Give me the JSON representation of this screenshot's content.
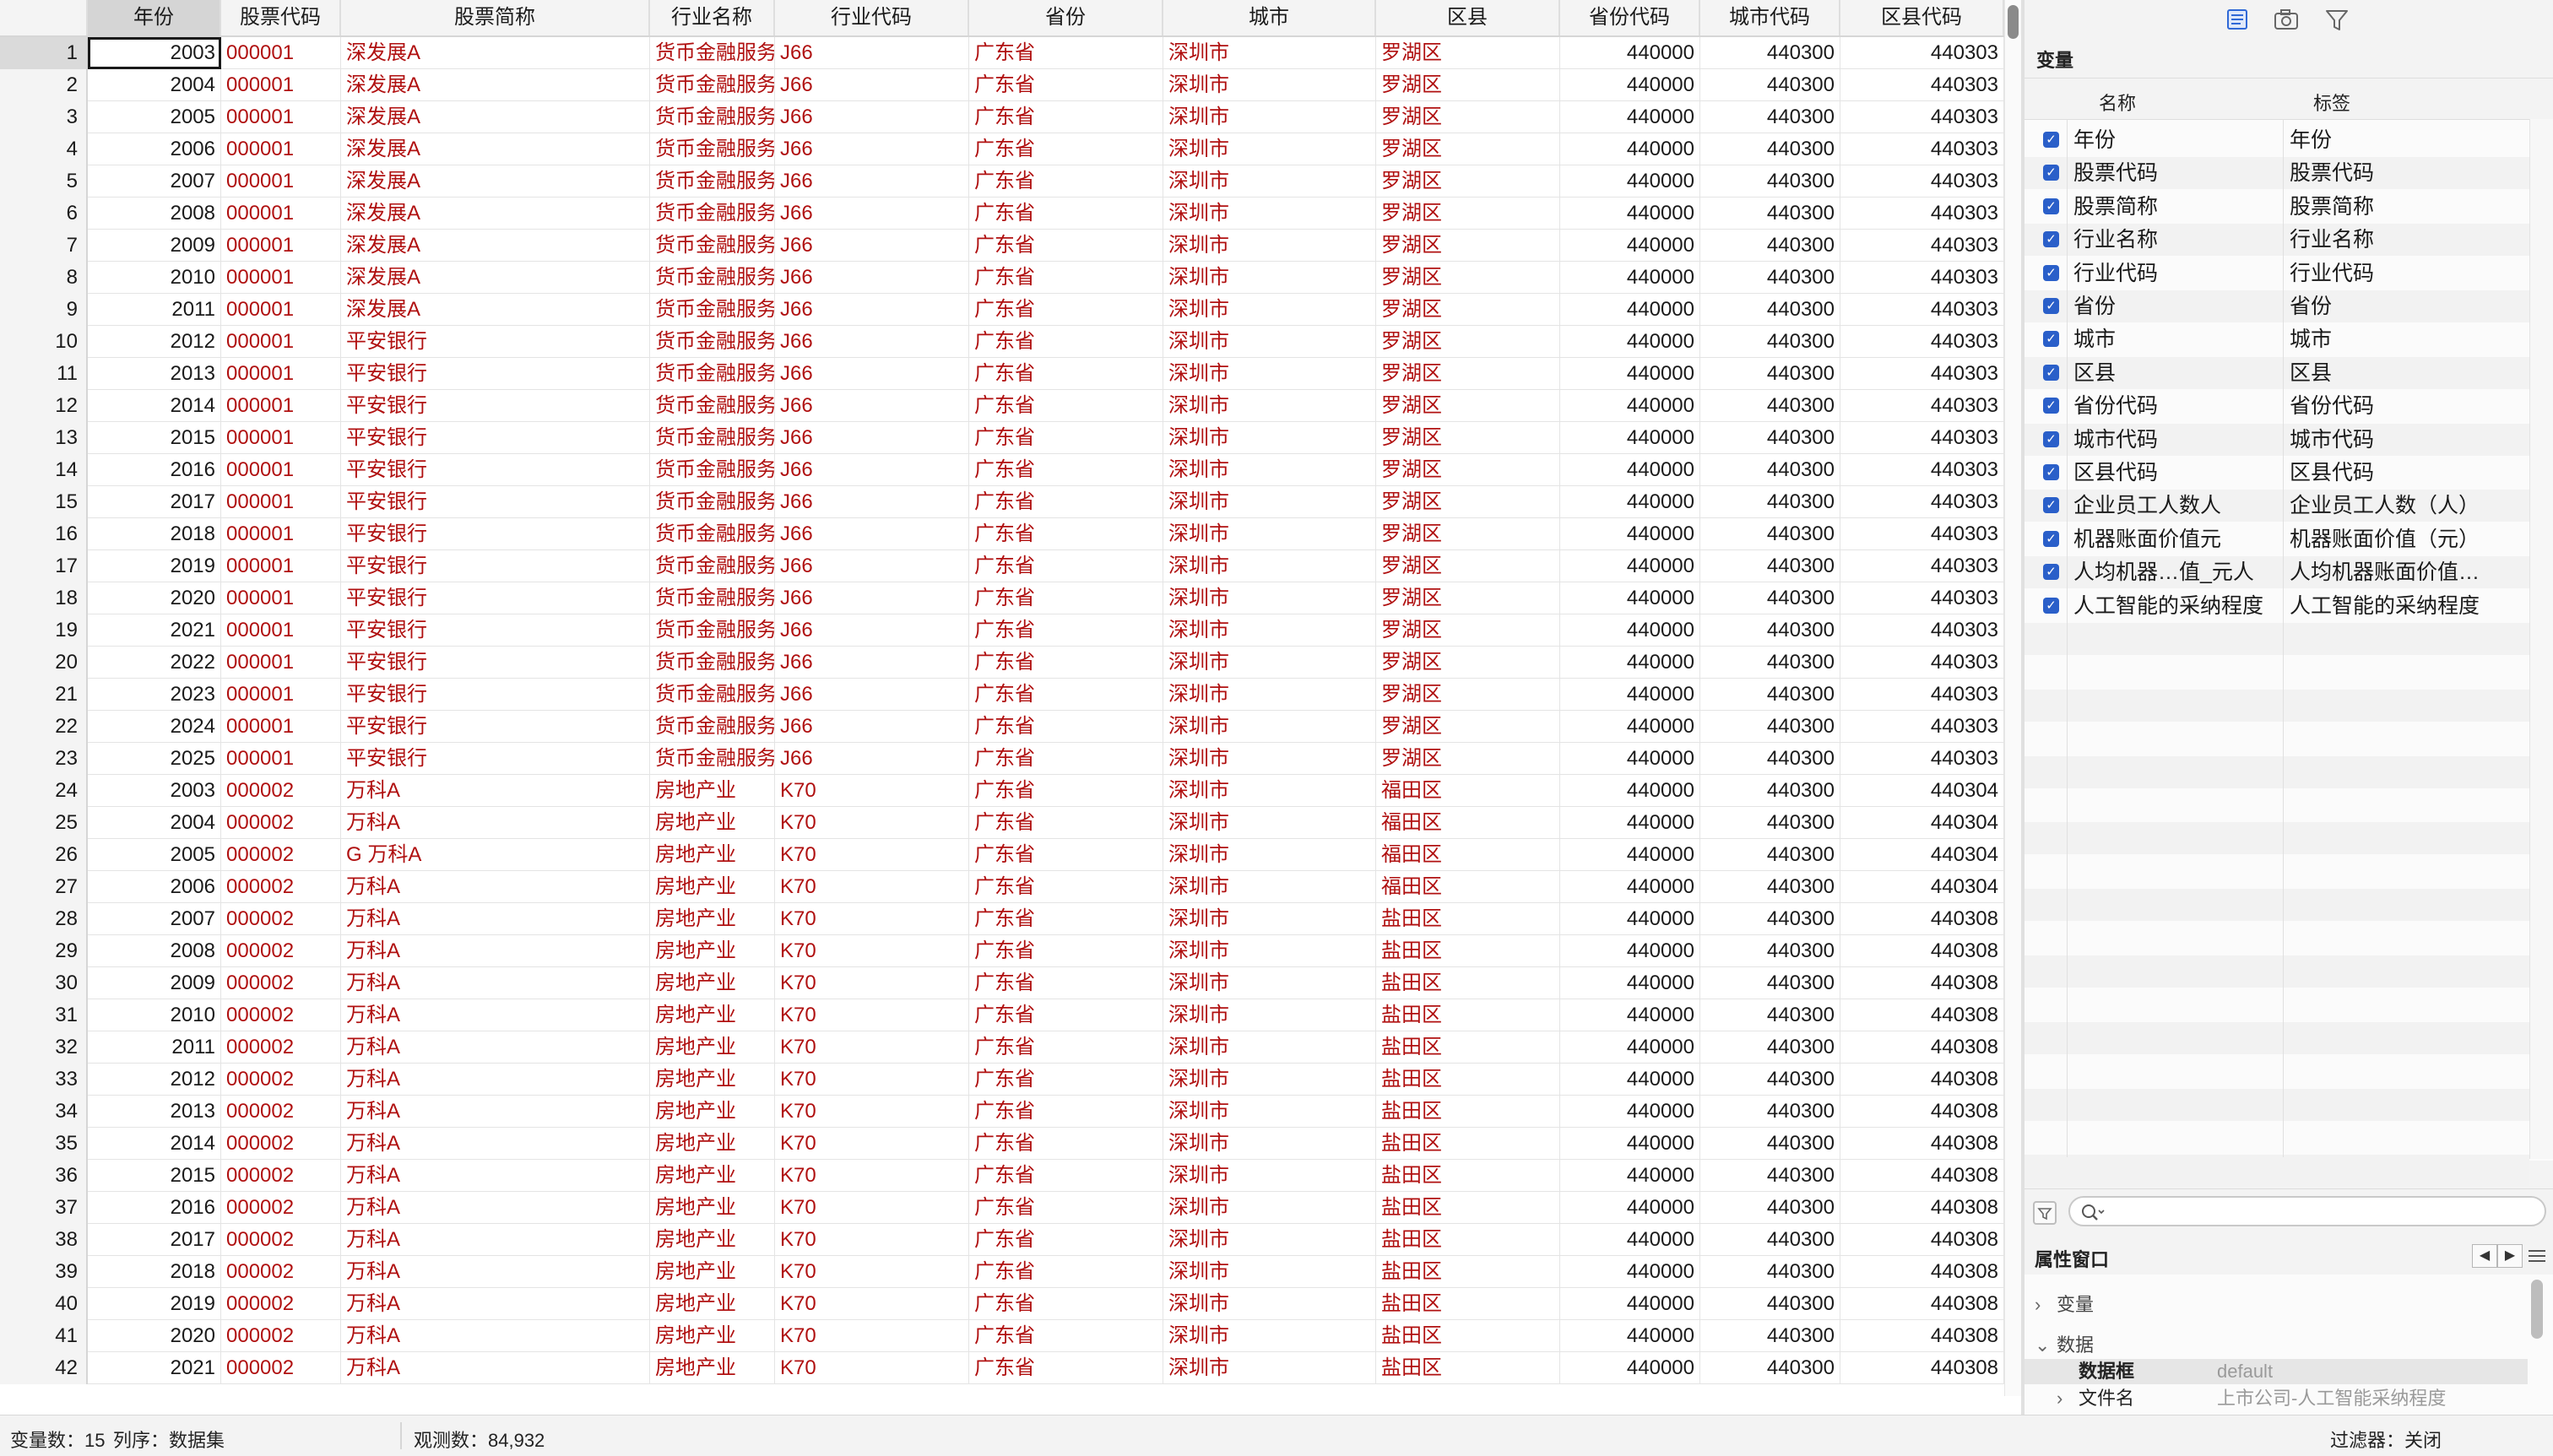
{
  "grid": {
    "columns": [
      "年份",
      "股票代码",
      "股票简称",
      "行业名称",
      "行业代码",
      "省份",
      "城市",
      "区县",
      "省份代码",
      "城市代码",
      "区县代码"
    ],
    "rows": [
      [
        1,
        "2003",
        "000001",
        "深发展A",
        "货币金融服务",
        "J66",
        "广东省",
        "深圳市",
        "罗湖区",
        "440000",
        "440300",
        "440303"
      ],
      [
        2,
        "2004",
        "000001",
        "深发展A",
        "货币金融服务",
        "J66",
        "广东省",
        "深圳市",
        "罗湖区",
        "440000",
        "440300",
        "440303"
      ],
      [
        3,
        "2005",
        "000001",
        "深发展A",
        "货币金融服务",
        "J66",
        "广东省",
        "深圳市",
        "罗湖区",
        "440000",
        "440300",
        "440303"
      ],
      [
        4,
        "2006",
        "000001",
        "深发展A",
        "货币金融服务",
        "J66",
        "广东省",
        "深圳市",
        "罗湖区",
        "440000",
        "440300",
        "440303"
      ],
      [
        5,
        "2007",
        "000001",
        "深发展A",
        "货币金融服务",
        "J66",
        "广东省",
        "深圳市",
        "罗湖区",
        "440000",
        "440300",
        "440303"
      ],
      [
        6,
        "2008",
        "000001",
        "深发展A",
        "货币金融服务",
        "J66",
        "广东省",
        "深圳市",
        "罗湖区",
        "440000",
        "440300",
        "440303"
      ],
      [
        7,
        "2009",
        "000001",
        "深发展A",
        "货币金融服务",
        "J66",
        "广东省",
        "深圳市",
        "罗湖区",
        "440000",
        "440300",
        "440303"
      ],
      [
        8,
        "2010",
        "000001",
        "深发展A",
        "货币金融服务",
        "J66",
        "广东省",
        "深圳市",
        "罗湖区",
        "440000",
        "440300",
        "440303"
      ],
      [
        9,
        "2011",
        "000001",
        "深发展A",
        "货币金融服务",
        "J66",
        "广东省",
        "深圳市",
        "罗湖区",
        "440000",
        "440300",
        "440303"
      ],
      [
        10,
        "2012",
        "000001",
        "平安银行",
        "货币金融服务",
        "J66",
        "广东省",
        "深圳市",
        "罗湖区",
        "440000",
        "440300",
        "440303"
      ],
      [
        11,
        "2013",
        "000001",
        "平安银行",
        "货币金融服务",
        "J66",
        "广东省",
        "深圳市",
        "罗湖区",
        "440000",
        "440300",
        "440303"
      ],
      [
        12,
        "2014",
        "000001",
        "平安银行",
        "货币金融服务",
        "J66",
        "广东省",
        "深圳市",
        "罗湖区",
        "440000",
        "440300",
        "440303"
      ],
      [
        13,
        "2015",
        "000001",
        "平安银行",
        "货币金融服务",
        "J66",
        "广东省",
        "深圳市",
        "罗湖区",
        "440000",
        "440300",
        "440303"
      ],
      [
        14,
        "2016",
        "000001",
        "平安银行",
        "货币金融服务",
        "J66",
        "广东省",
        "深圳市",
        "罗湖区",
        "440000",
        "440300",
        "440303"
      ],
      [
        15,
        "2017",
        "000001",
        "平安银行",
        "货币金融服务",
        "J66",
        "广东省",
        "深圳市",
        "罗湖区",
        "440000",
        "440300",
        "440303"
      ],
      [
        16,
        "2018",
        "000001",
        "平安银行",
        "货币金融服务",
        "J66",
        "广东省",
        "深圳市",
        "罗湖区",
        "440000",
        "440300",
        "440303"
      ],
      [
        17,
        "2019",
        "000001",
        "平安银行",
        "货币金融服务",
        "J66",
        "广东省",
        "深圳市",
        "罗湖区",
        "440000",
        "440300",
        "440303"
      ],
      [
        18,
        "2020",
        "000001",
        "平安银行",
        "货币金融服务",
        "J66",
        "广东省",
        "深圳市",
        "罗湖区",
        "440000",
        "440300",
        "440303"
      ],
      [
        19,
        "2021",
        "000001",
        "平安银行",
        "货币金融服务",
        "J66",
        "广东省",
        "深圳市",
        "罗湖区",
        "440000",
        "440300",
        "440303"
      ],
      [
        20,
        "2022",
        "000001",
        "平安银行",
        "货币金融服务",
        "J66",
        "广东省",
        "深圳市",
        "罗湖区",
        "440000",
        "440300",
        "440303"
      ],
      [
        21,
        "2023",
        "000001",
        "平安银行",
        "货币金融服务",
        "J66",
        "广东省",
        "深圳市",
        "罗湖区",
        "440000",
        "440300",
        "440303"
      ],
      [
        22,
        "2024",
        "000001",
        "平安银行",
        "货币金融服务",
        "J66",
        "广东省",
        "深圳市",
        "罗湖区",
        "440000",
        "440300",
        "440303"
      ],
      [
        23,
        "2025",
        "000001",
        "平安银行",
        "货币金融服务",
        "J66",
        "广东省",
        "深圳市",
        "罗湖区",
        "440000",
        "440300",
        "440303"
      ],
      [
        24,
        "2003",
        "000002",
        "万科A",
        "房地产业",
        "K70",
        "广东省",
        "深圳市",
        "福田区",
        "440000",
        "440300",
        "440304"
      ],
      [
        25,
        "2004",
        "000002",
        "万科A",
        "房地产业",
        "K70",
        "广东省",
        "深圳市",
        "福田区",
        "440000",
        "440300",
        "440304"
      ],
      [
        26,
        "2005",
        "000002",
        "G 万科A",
        "房地产业",
        "K70",
        "广东省",
        "深圳市",
        "福田区",
        "440000",
        "440300",
        "440304"
      ],
      [
        27,
        "2006",
        "000002",
        "万科A",
        "房地产业",
        "K70",
        "广东省",
        "深圳市",
        "福田区",
        "440000",
        "440300",
        "440304"
      ],
      [
        28,
        "2007",
        "000002",
        "万科A",
        "房地产业",
        "K70",
        "广东省",
        "深圳市",
        "盐田区",
        "440000",
        "440300",
        "440308"
      ],
      [
        29,
        "2008",
        "000002",
        "万科A",
        "房地产业",
        "K70",
        "广东省",
        "深圳市",
        "盐田区",
        "440000",
        "440300",
        "440308"
      ],
      [
        30,
        "2009",
        "000002",
        "万科A",
        "房地产业",
        "K70",
        "广东省",
        "深圳市",
        "盐田区",
        "440000",
        "440300",
        "440308"
      ],
      [
        31,
        "2010",
        "000002",
        "万科A",
        "房地产业",
        "K70",
        "广东省",
        "深圳市",
        "盐田区",
        "440000",
        "440300",
        "440308"
      ],
      [
        32,
        "2011",
        "000002",
        "万科A",
        "房地产业",
        "K70",
        "广东省",
        "深圳市",
        "盐田区",
        "440000",
        "440300",
        "440308"
      ],
      [
        33,
        "2012",
        "000002",
        "万科A",
        "房地产业",
        "K70",
        "广东省",
        "深圳市",
        "盐田区",
        "440000",
        "440300",
        "440308"
      ],
      [
        34,
        "2013",
        "000002",
        "万科A",
        "房地产业",
        "K70",
        "广东省",
        "深圳市",
        "盐田区",
        "440000",
        "440300",
        "440308"
      ],
      [
        35,
        "2014",
        "000002",
        "万科A",
        "房地产业",
        "K70",
        "广东省",
        "深圳市",
        "盐田区",
        "440000",
        "440300",
        "440308"
      ],
      [
        36,
        "2015",
        "000002",
        "万科A",
        "房地产业",
        "K70",
        "广东省",
        "深圳市",
        "盐田区",
        "440000",
        "440300",
        "440308"
      ],
      [
        37,
        "2016",
        "000002",
        "万科A",
        "房地产业",
        "K70",
        "广东省",
        "深圳市",
        "盐田区",
        "440000",
        "440300",
        "440308"
      ],
      [
        38,
        "2017",
        "000002",
        "万科A",
        "房地产业",
        "K70",
        "广东省",
        "深圳市",
        "盐田区",
        "440000",
        "440300",
        "440308"
      ],
      [
        39,
        "2018",
        "000002",
        "万科A",
        "房地产业",
        "K70",
        "广东省",
        "深圳市",
        "盐田区",
        "440000",
        "440300",
        "440308"
      ],
      [
        40,
        "2019",
        "000002",
        "万科A",
        "房地产业",
        "K70",
        "广东省",
        "深圳市",
        "盐田区",
        "440000",
        "440300",
        "440308"
      ],
      [
        41,
        "2020",
        "000002",
        "万科A",
        "房地产业",
        "K70",
        "广东省",
        "深圳市",
        "盐田区",
        "440000",
        "440300",
        "440308"
      ],
      [
        42,
        "2021",
        "000002",
        "万科A",
        "房地产业",
        "K70",
        "广东省",
        "深圳市",
        "盐田区",
        "440000",
        "440300",
        "440308"
      ]
    ]
  },
  "variables_panel": {
    "toolbar_icons": [
      "variables-list-icon",
      "camera-icon",
      "filter-icon"
    ],
    "title": "变量",
    "col_name": "名称",
    "col_label": "标签",
    "items": [
      {
        "name": "年份",
        "label": "年份"
      },
      {
        "name": "股票代码",
        "label": "股票代码"
      },
      {
        "name": "股票简称",
        "label": "股票简称"
      },
      {
        "name": "行业名称",
        "label": "行业名称"
      },
      {
        "name": "行业代码",
        "label": "行业代码"
      },
      {
        "name": "省份",
        "label": "省份"
      },
      {
        "name": "城市",
        "label": "城市"
      },
      {
        "name": "区县",
        "label": "区县"
      },
      {
        "name": "省份代码",
        "label": "省份代码"
      },
      {
        "name": "城市代码",
        "label": "城市代码"
      },
      {
        "name": "区县代码",
        "label": "区县代码"
      },
      {
        "name": "企业员工人数人",
        "label": "企业员工人数（人）"
      },
      {
        "name": "机器账面价值元",
        "label": "机器账面价值（元）"
      },
      {
        "name": "人均机器…值_元人",
        "label": "人均机器账面价值…"
      },
      {
        "name": "人工智能的采纳程度",
        "label": "人工智能的采纳程度"
      }
    ],
    "search_placeholder": ""
  },
  "properties": {
    "title": "属性窗口",
    "prev": "◀",
    "next": "▶",
    "node_variables": "变量",
    "node_data": "数据",
    "frame_key": "数据框",
    "frame_value": "default",
    "file_key": "文件名",
    "file_value": "上市公司-人工智能采纳程度"
  },
  "status": {
    "var_count": "变量数：15",
    "order": "列序：数据集",
    "obs": "观测数：84,932",
    "filter": "过滤器：关闭"
  },
  "colors": {
    "string_text": "#b01010",
    "checkbox": "#2a5fc9"
  }
}
